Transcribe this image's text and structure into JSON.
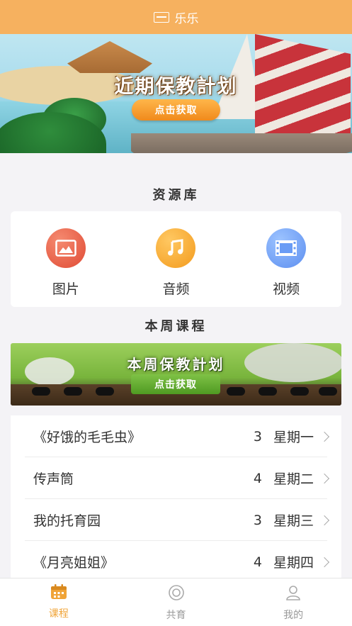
{
  "header": {
    "title": "乐乐",
    "logo_icon": "book-icon"
  },
  "hero": {
    "title": "近期保教計划",
    "button": "点击获取"
  },
  "resources": {
    "title": "资源库",
    "items": [
      {
        "label": "图片",
        "icon": "image-icon",
        "color": "#e8563f"
      },
      {
        "label": "音频",
        "icon": "music-note-icon",
        "color": "#f5a52a"
      },
      {
        "label": "视频",
        "icon": "film-icon",
        "color": "#6a9cf5"
      }
    ]
  },
  "weekly": {
    "title": "本周课程",
    "banner_title": "本周保教計划",
    "banner_button": "点击获取"
  },
  "courses": [
    {
      "name": "《好饿的毛毛虫》",
      "count": "3",
      "day": "星期一"
    },
    {
      "name": "传声筒",
      "count": "4",
      "day": "星期二"
    },
    {
      "name": "我的托育园",
      "count": "3",
      "day": "星期三"
    },
    {
      "name": "《月亮姐姐》",
      "count": "4",
      "day": "星期四"
    }
  ],
  "nav": [
    {
      "label": "课程",
      "icon": "calendar-icon",
      "active": true
    },
    {
      "label": "共育",
      "icon": "circle-icon",
      "active": false
    },
    {
      "label": "我的",
      "icon": "user-icon",
      "active": false
    }
  ],
  "colors": {
    "accent": "#f6b15f",
    "active": "#f0a438"
  }
}
